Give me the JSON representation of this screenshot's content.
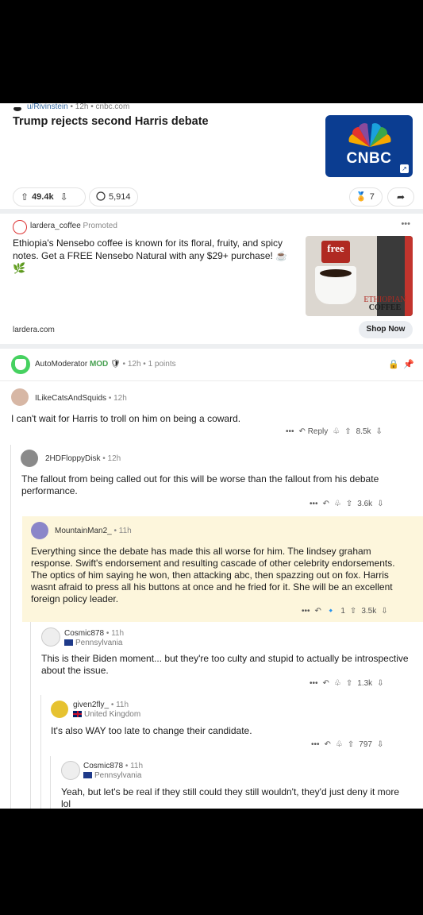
{
  "post": {
    "author": "u/Rivinstein",
    "age": "12h",
    "domain": "cnbc.com",
    "title": "Trump rejects second Harris debate",
    "thumb_label": "CNBC",
    "upvotes": "49.4k",
    "comments": "5,914",
    "awards": "7"
  },
  "ad": {
    "advertiser": "lardera_coffee",
    "promoted": "Promoted",
    "text": "Ethiopia's Nensebo coffee is known for its floral, fruity, and spicy notes. Get a FREE Nensebo Natural with any $29+ purchase! ☕",
    "img_free": "free",
    "img_line1": "ETHIOPIAN",
    "img_line2": "COFFEE",
    "domain": "lardera.com",
    "cta": "Shop Now"
  },
  "automod": {
    "name": "AutoModerator",
    "badge": "MOD",
    "age": "12h",
    "points": "1 points"
  },
  "comments": [
    {
      "user": "ILikeCatsAndSquids",
      "age": "12h",
      "flair": "",
      "text": "I can't wait for Harris to troll on him on being a coward.",
      "votes": "8.5k",
      "reply": "Reply"
    },
    {
      "user": "2HDFloppyDisk",
      "age": "12h",
      "flair": "",
      "text": "The fallout from being called out for this will be worse than the fallout from his debate performance.",
      "votes": "3.6k"
    },
    {
      "user": "MountainMan2_",
      "age": "11h",
      "flair": "",
      "text": "Everything since the debate has made this all worse for him. The lindsey graham response. Swift's endorsement and resulting cascade of other celebrity endorsements. The optics of him saying he won, then attacking abc, then spazzing out on fox. Harris wasnt afraid to press all his buttons at once and he fried for it. She will be an excellent foreign policy leader.",
      "votes": "3.5k",
      "award_count": "1"
    },
    {
      "user": "Cosmic878",
      "age": "11h",
      "flair": "Pennsylvania",
      "text": "This is their Biden moment... but they're too culty and stupid to actually be introspective about the issue.",
      "votes": "1.3k"
    },
    {
      "user": "given2fly_",
      "age": "11h",
      "flair": "United Kingdom",
      "text": "It's also WAY too late to change their candidate.",
      "votes": "797"
    },
    {
      "user": "Cosmic878",
      "age": "11h",
      "flair": "Pennsylvania",
      "text": "Yeah, but let's be real if they still could they still wouldn't, they'd just deny it more lol",
      "votes": ""
    }
  ],
  "colors": {
    "cnbc_bg": "#0b3d91",
    "highlight": "#fdf6dc",
    "mod_green": "#46d160",
    "link": "#3a6ea5"
  }
}
